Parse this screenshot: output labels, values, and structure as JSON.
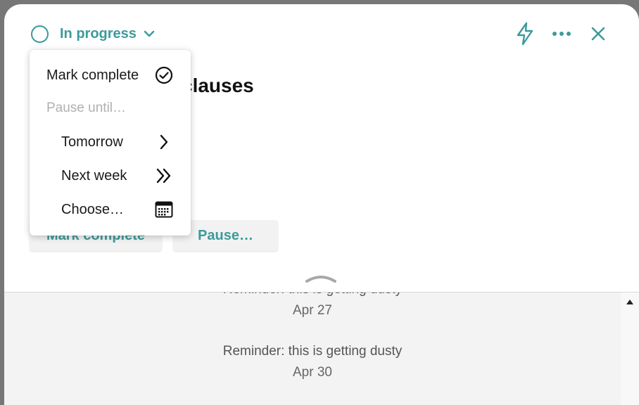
{
  "header": {
    "status_label": "In progress",
    "icons": [
      "circle-status-icon",
      "chevron-down-icon",
      "lightning-icon",
      "more-icon",
      "close-icon"
    ]
  },
  "task": {
    "title_visible": "clauses"
  },
  "actions": {
    "mark_complete": "Mark complete",
    "pause": "Pause…"
  },
  "menu": {
    "mark_complete": "Mark complete",
    "pause_until": "Pause until…",
    "tomorrow": "Tomorrow",
    "next_week": "Next week",
    "choose": "Choose…"
  },
  "activity": [
    {
      "message": "Reminder: this is getting dusty",
      "date": "Apr 27"
    },
    {
      "message": "Reminder: this is getting dusty",
      "date": "Apr 30"
    }
  ],
  "colors": {
    "accent": "#3d9a9b",
    "backdrop": "#777777",
    "activity_bg": "#f3f3f3"
  }
}
